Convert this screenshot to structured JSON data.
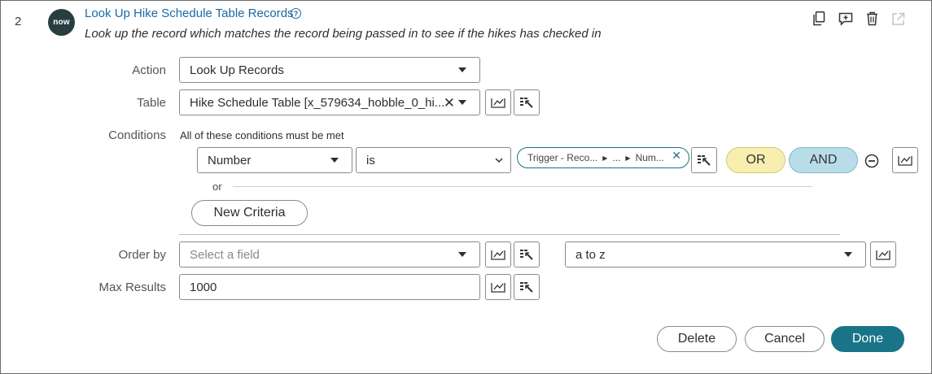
{
  "step": {
    "number": "2",
    "avatar_text": "now",
    "title": "Look Up Hike Schedule Table Records",
    "description": "Look up the record which matches the record being passed in to see if the hikes has checked in"
  },
  "top_actions": {
    "icons": [
      "copy-icon",
      "add-comment-icon",
      "trash-icon",
      "open-external-icon"
    ]
  },
  "form": {
    "action": {
      "label": "Action",
      "value": "Look Up Records"
    },
    "table": {
      "label": "Table",
      "value": "Hike Schedule Table [x_579634_hobble_0_hi..."
    },
    "conditions": {
      "label": "Conditions",
      "hint": "All of these conditions must be met",
      "field_value": "Number",
      "operator_value": "is",
      "pill_part1": "Trigger - Reco...",
      "pill_part2": "...",
      "pill_part3": "Num...",
      "or_button": "OR",
      "and_button": "AND",
      "or_separator": "or",
      "new_criteria": "New Criteria"
    },
    "order_by": {
      "label": "Order by",
      "placeholder": "Select a field",
      "direction": "a to z"
    },
    "max_results": {
      "label": "Max Results",
      "value": "1000"
    }
  },
  "footer": {
    "delete": "Delete",
    "cancel": "Cancel",
    "done": "Done"
  },
  "colors": {
    "accent": "#1a6aa6",
    "primary_button": "#1a7488",
    "or_fill": "#f7eeb0",
    "and_fill": "#b9dde8",
    "pill_border": "#1a7488"
  }
}
